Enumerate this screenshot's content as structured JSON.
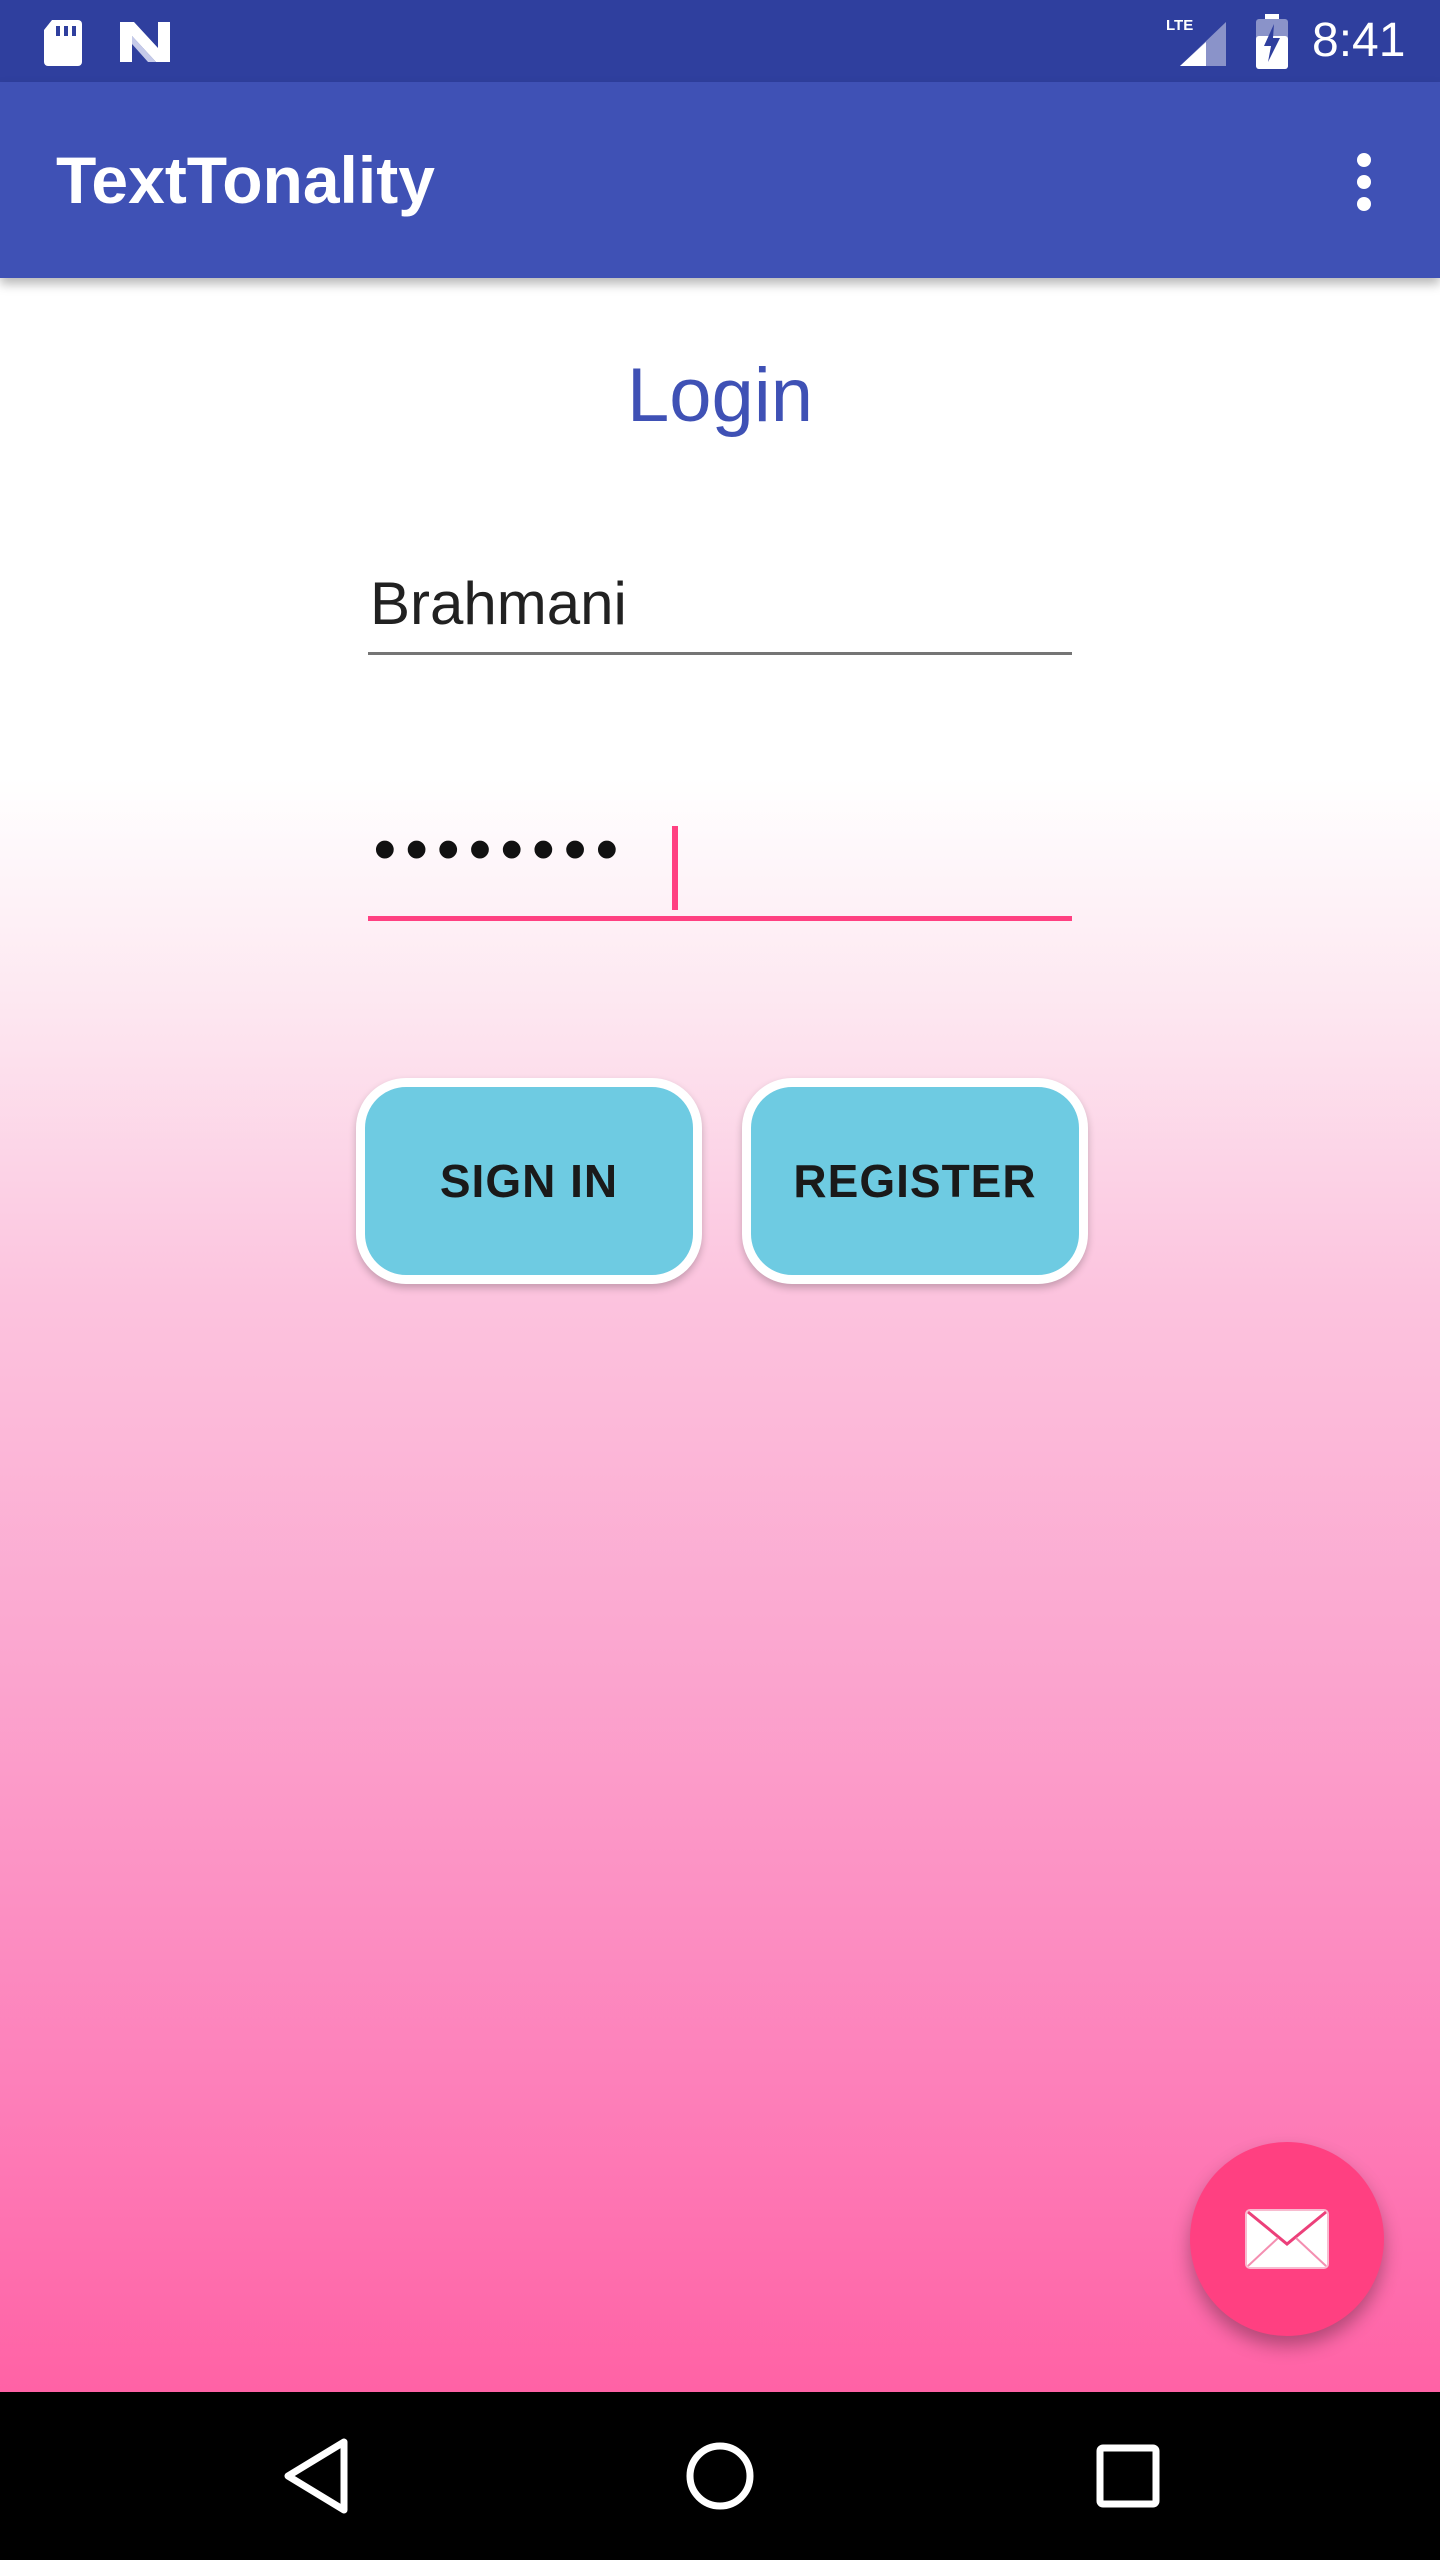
{
  "status_bar": {
    "time": "8:41",
    "network_label": "LTE",
    "icons": [
      "sd-card-icon",
      "n-logo-icon",
      "lte-signal-icon",
      "battery-charging-icon"
    ]
  },
  "app_bar": {
    "title": "TextTonality",
    "overflow_icon": "more-vert-icon"
  },
  "login": {
    "title": "Login",
    "username_value": "Brahmani",
    "password_value": "••••••••",
    "sign_in_label": "SIGN IN",
    "register_label": "REGISTER"
  },
  "fab": {
    "icon": "envelope-icon"
  },
  "nav_bar": {
    "icons": [
      "back-icon",
      "home-icon",
      "recents-icon"
    ]
  },
  "colors": {
    "status_bar": "#2f3f9e",
    "primary": "#3f51b5",
    "accent": "#ff4081",
    "button": "#6ecbe2"
  }
}
